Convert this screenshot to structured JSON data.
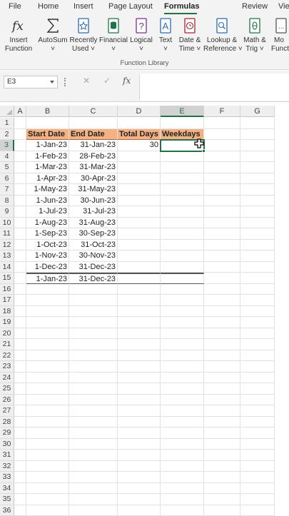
{
  "menu": {
    "tabs": [
      {
        "label": "File"
      },
      {
        "label": "Home"
      },
      {
        "label": "Insert"
      },
      {
        "label": "Page Layout"
      },
      {
        "label": "Formulas"
      },
      {
        "label": "Review"
      },
      {
        "label": "Vie"
      }
    ],
    "active_tab": "Formulas"
  },
  "ribbon": {
    "buttons": [
      {
        "line1": "Insert",
        "line2": "Function",
        "icon": "fx-icon"
      },
      {
        "line1": "AutoSum",
        "line2": "˅",
        "icon": "sigma-icon"
      },
      {
        "line1": "Recently",
        "line2": "Used ˅",
        "icon": "star-book-icon"
      },
      {
        "line1": "Financial",
        "line2": "˅",
        "icon": "database-book-icon"
      },
      {
        "line1": "Logical",
        "line2": "˅",
        "icon": "question-book-icon"
      },
      {
        "line1": "Text",
        "line2": "˅",
        "icon": "text-book-icon"
      },
      {
        "line1": "Date &",
        "line2": "Time ˅",
        "icon": "clock-book-icon"
      },
      {
        "line1": "Lookup &",
        "line2": "Reference ˅",
        "icon": "search-book-icon"
      },
      {
        "line1": "Math &",
        "line2": "Trig ˅",
        "icon": "theta-book-icon"
      },
      {
        "line1": "Mo",
        "line2": "Functio",
        "icon": "more-book-icon"
      }
    ],
    "group_label": "Function Library"
  },
  "formula_bar": {
    "name_box": "E3",
    "cancel_icon": "✕",
    "enter_icon": "✓",
    "fx_icon": "fx",
    "formula": ""
  },
  "grid": {
    "columns": [
      "A",
      "B",
      "C",
      "D",
      "E",
      "F",
      "G"
    ],
    "selected_column": "E",
    "rows": [
      "1",
      "2",
      "3",
      "4",
      "5",
      "6",
      "7",
      "8",
      "9",
      "10",
      "11",
      "12",
      "13",
      "14",
      "15",
      "16",
      "17",
      "18",
      "19",
      "20",
      "21",
      "22",
      "23",
      "24",
      "25",
      "26",
      "27",
      "28",
      "29",
      "30",
      "31",
      "32",
      "33",
      "34",
      "35",
      "36"
    ],
    "selected_row": "3",
    "header_row": {
      "b": "Start Date",
      "c": "End Date",
      "d": "Total Days",
      "e": "Weekdays"
    },
    "data_rows": [
      {
        "b": "1-Jan-23",
        "c": "31-Jan-23",
        "d": "30",
        "e": ""
      },
      {
        "b": "1-Feb-23",
        "c": "28-Feb-23",
        "d": "",
        "e": ""
      },
      {
        "b": "1-Mar-23",
        "c": "31-Mar-23",
        "d": "",
        "e": ""
      },
      {
        "b": "1-Apr-23",
        "c": "30-Apr-23",
        "d": "",
        "e": ""
      },
      {
        "b": "1-May-23",
        "c": "31-May-23",
        "d": "",
        "e": ""
      },
      {
        "b": "1-Jun-23",
        "c": "30-Jun-23",
        "d": "",
        "e": ""
      },
      {
        "b": "1-Jul-23",
        "c": "31-Jul-23",
        "d": "",
        "e": ""
      },
      {
        "b": "1-Aug-23",
        "c": "31-Aug-23",
        "d": "",
        "e": ""
      },
      {
        "b": "1-Sep-23",
        "c": "30-Sep-23",
        "d": "",
        "e": ""
      },
      {
        "b": "1-Oct-23",
        "c": "31-Oct-23",
        "d": "",
        "e": ""
      },
      {
        "b": "1-Nov-23",
        "c": "30-Nov-23",
        "d": "",
        "e": ""
      },
      {
        "b": "1-Dec-23",
        "c": "31-Dec-23",
        "d": "",
        "e": ""
      },
      {
        "b": "1-Jan-23",
        "c": "31-Dec-23",
        "d": "",
        "e": ""
      }
    ]
  },
  "colors": {
    "accent": "#217346",
    "header_fill": "#f4b183"
  }
}
